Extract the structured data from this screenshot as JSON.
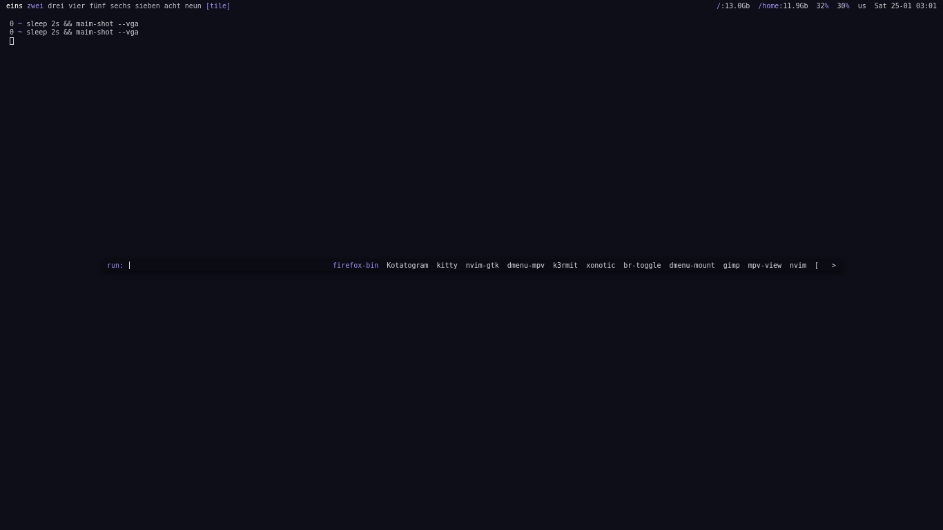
{
  "workspaces": [
    {
      "label": "eins",
      "selected": false,
      "occupied": true
    },
    {
      "label": "zwei",
      "selected": true,
      "occupied": false
    },
    {
      "label": "drei",
      "selected": false,
      "occupied": false
    },
    {
      "label": "vier",
      "selected": false,
      "occupied": false
    },
    {
      "label": "fünf",
      "selected": false,
      "occupied": false
    },
    {
      "label": "sechs",
      "selected": false,
      "occupied": false
    },
    {
      "label": "sieben",
      "selected": false,
      "occupied": false
    },
    {
      "label": "acht",
      "selected": false,
      "occupied": false
    },
    {
      "label": "neun",
      "selected": false,
      "occupied": false
    }
  ],
  "layout": "[tile]",
  "status": [
    {
      "parts": [
        {
          "text": "/",
          "accent": true
        },
        {
          "text": ":13.0Gb",
          "accent": false
        }
      ]
    },
    {
      "parts": [
        {
          "text": "/home",
          "accent": true
        },
        {
          "text": ":11.9Gb",
          "accent": false
        }
      ]
    },
    {
      "parts": [
        {
          "text": "32",
          "accent": false
        },
        {
          "text": "%",
          "accent": true
        }
      ]
    },
    {
      "parts": [
        {
          "text": "30",
          "accent": false
        },
        {
          "text": "%",
          "accent": true
        }
      ]
    },
    {
      "parts": [
        {
          "text": "us",
          "accent": false
        }
      ]
    },
    {
      "parts": [
        {
          "text": "Sat 25-01 03:01",
          "accent": false
        }
      ]
    }
  ],
  "terminal": {
    "lines": [
      {
        "status": "0",
        "dir": "~",
        "command": "sleep 2s && maim-shot --vga"
      },
      {
        "status": "0",
        "dir": "~",
        "command": "sleep 2s && maim-shot --vga"
      }
    ]
  },
  "launcher": {
    "prompt": "run:",
    "items": [
      {
        "label": "firefox-bin",
        "selected": true
      },
      {
        "label": "Kotatogram",
        "selected": false
      },
      {
        "label": "kitty",
        "selected": false
      },
      {
        "label": "nvim-gtk",
        "selected": false
      },
      {
        "label": "dmenu-mpv",
        "selected": false
      },
      {
        "label": "k3rmit",
        "selected": false
      },
      {
        "label": "xonotic",
        "selected": false
      },
      {
        "label": "br-toggle",
        "selected": false
      },
      {
        "label": "dmenu-mount",
        "selected": false
      },
      {
        "label": "gimp",
        "selected": false
      },
      {
        "label": "mpv-view",
        "selected": false
      },
      {
        "label": "nvim",
        "selected": false
      },
      {
        "label": "[",
        "selected": false
      }
    ],
    "more": ">"
  }
}
